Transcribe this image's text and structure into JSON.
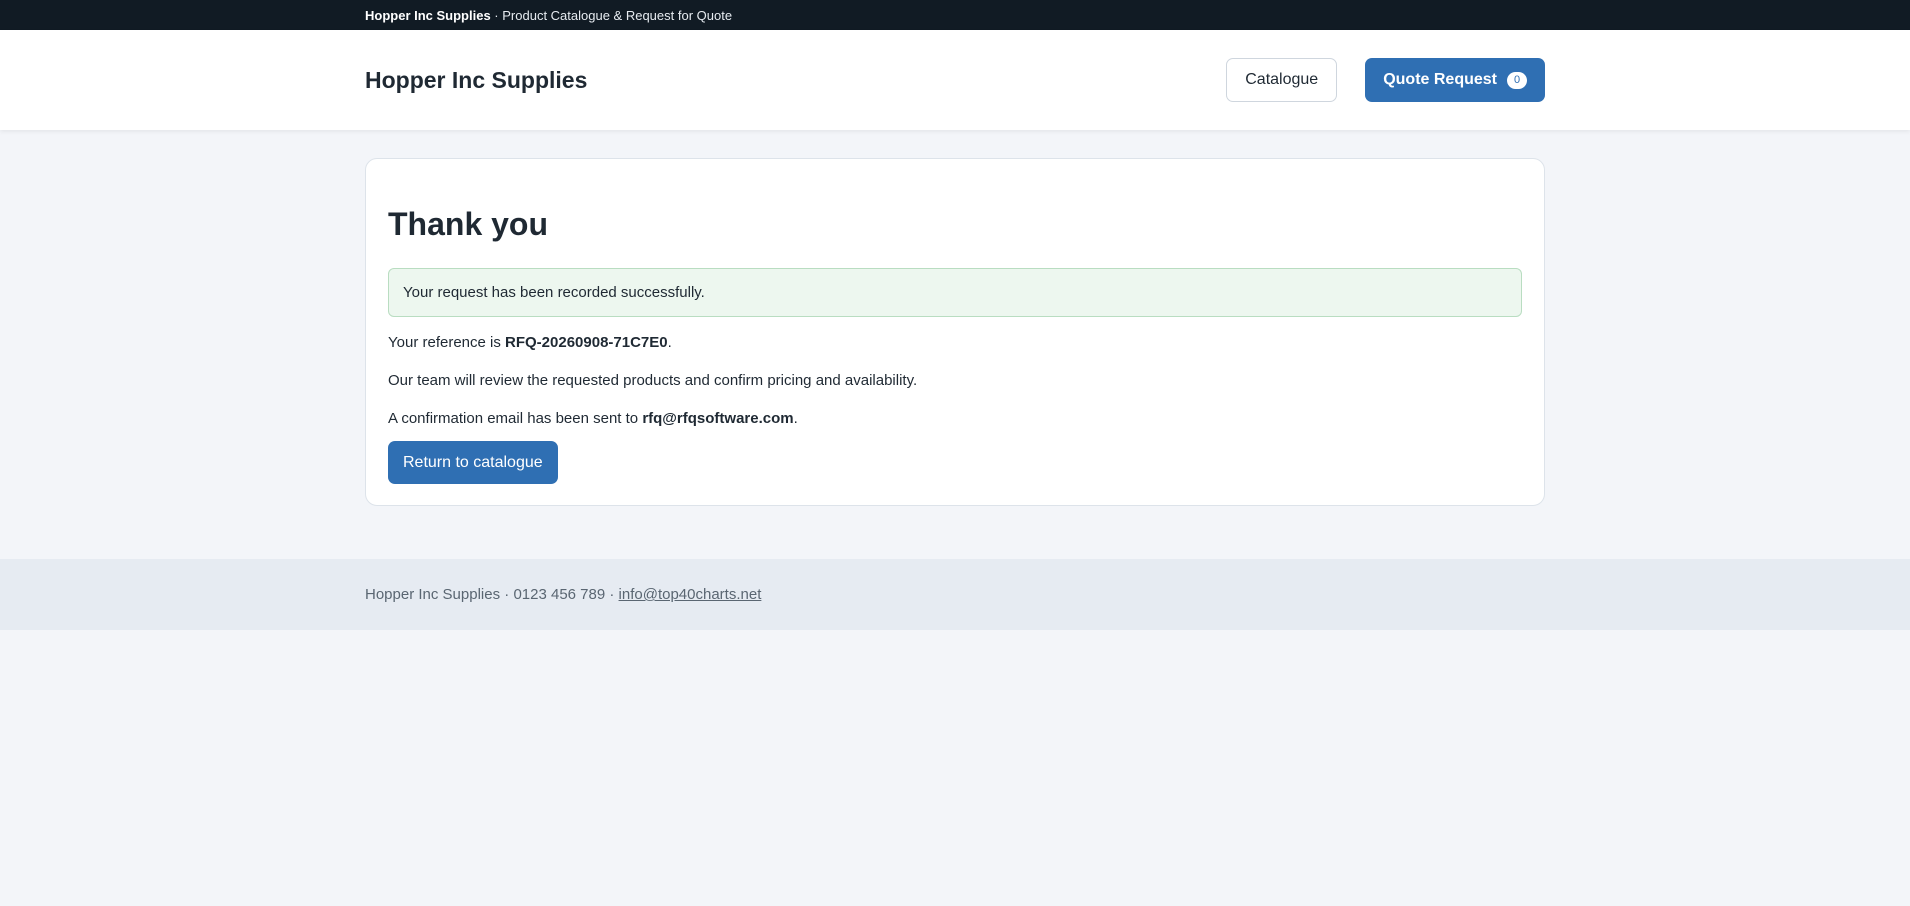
{
  "topbar": {
    "brand": "Hopper Inc Supplies",
    "separator": " · ",
    "tagline": "Product Catalogue & Request for Quote"
  },
  "header": {
    "brand": "Hopper Inc Supplies",
    "nav": {
      "catalogue_label": "Catalogue",
      "quote_label": "Quote Request",
      "quote_count": "0"
    }
  },
  "main": {
    "title": "Thank you",
    "alert": "Your request has been recorded successfully.",
    "reference_prefix": "Your reference is ",
    "reference_value": "RFQ-20260908-71C7E0",
    "reference_suffix": ".",
    "review_text": "Our team will review the requested products and confirm pricing and availability.",
    "email_prefix": "A confirmation email has been sent to ",
    "email_value": "rfq@rfqsoftware.com",
    "email_suffix": ".",
    "return_label": "Return to catalogue"
  },
  "footer": {
    "company": "Hopper Inc Supplies",
    "separator1": " · ",
    "phone": "0123 456 789",
    "separator2": " · ",
    "email": "info@top40charts.net"
  },
  "colors": {
    "topbar_bg": "#111b24",
    "primary": "#2f6fb3",
    "page_bg": "#f3f5f9",
    "alert_bg": "#edf7ef",
    "footer_bg": "#e6ebf2"
  }
}
